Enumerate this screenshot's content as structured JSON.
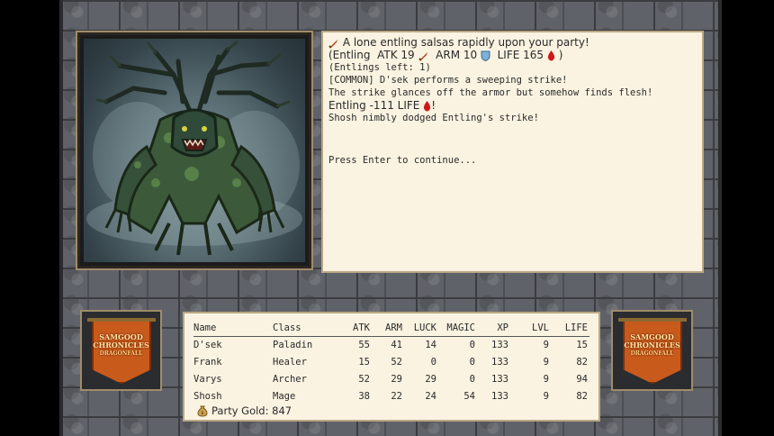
{
  "log": {
    "line1": "A lone entling salsas rapidly upon your party!",
    "stats_prefix": "(Entling",
    "stats_atk": "ATK 19",
    "stats_arm": "ARM 10",
    "stats_life": "LIFE 165",
    "stats_suffix": ")",
    "line3": "(Entlings left: 1)",
    "line4": "[COMMON] D'sek performs a sweeping strike!",
    "line5": "The strike glances off the armor but somehow finds flesh!",
    "damage_text": "Entling -111 LIFE",
    "damage_suffix": "!",
    "line7": "Shosh nimbly dodged Entling's strike!",
    "prompt": "Press Enter to continue..."
  },
  "banner": {
    "title_line1": "SAMGOOD",
    "title_line2": "CHRONICLES",
    "subtitle": "DRAGONFALL"
  },
  "party": {
    "headers": [
      "Name",
      "Class",
      "ATK",
      "ARM",
      "LUCK",
      "MAGIC",
      "XP",
      "LVL",
      "LIFE"
    ],
    "rows": [
      [
        "D'sek",
        "Paladin",
        "55",
        "41",
        "14",
        "0",
        "133",
        "9",
        "15"
      ],
      [
        "Frank",
        "Healer",
        "15",
        "52",
        "0",
        "0",
        "133",
        "9",
        "82"
      ],
      [
        "Varys",
        "Archer",
        "52",
        "29",
        "29",
        "0",
        "133",
        "9",
        "94"
      ],
      [
        "Shosh",
        "Mage",
        "38",
        "22",
        "24",
        "54",
        "133",
        "9",
        "82"
      ]
    ],
    "gold_label": "Party Gold: 847"
  },
  "colors": {
    "parchment": "#faf3e1",
    "frame": "#a08c6a",
    "stone": "#5f6268",
    "banner_orange": "#c85a1c"
  },
  "icons": {
    "dagger": "dagger-icon",
    "shield": "shield-icon",
    "blood_drop": "blood-drop-icon",
    "gold_bag": "gold-bag-icon"
  }
}
